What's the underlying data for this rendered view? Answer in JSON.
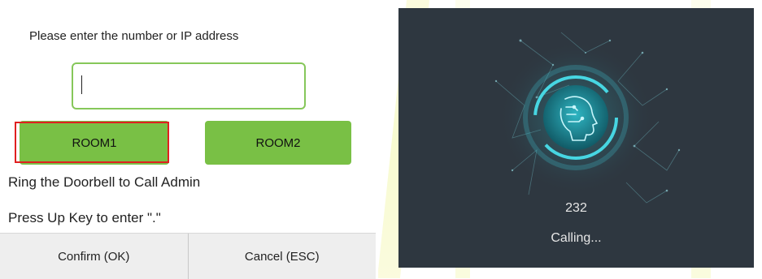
{
  "input_dialog": {
    "prompt": "Please enter the number or IP address",
    "input_value": "",
    "rooms": [
      {
        "label": "ROOM1",
        "selected": true
      },
      {
        "label": "ROOM2",
        "selected": false
      }
    ],
    "info_lines": [
      "Ring the Doorbell to Call Admin",
      "Press Up Key to enter \".\""
    ],
    "actions": {
      "confirm_label": "Confirm (OK)",
      "cancel_label": "Cancel (ESC)"
    }
  },
  "call_screen": {
    "number": "232",
    "status": "Calling..."
  },
  "colors": {
    "accent_green": "#79c045",
    "input_border": "#86c75a",
    "selection_outline": "#e02020",
    "call_background": "#2e3740",
    "ring_cyan": "#3ec9d6"
  }
}
